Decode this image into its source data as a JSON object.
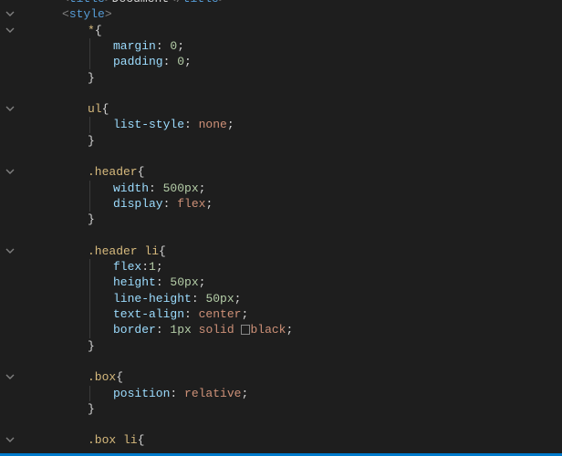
{
  "editor": {
    "file_title": "Document",
    "lines": [
      {
        "indent": 1,
        "tokens": [
          {
            "t": "tag",
            "v": "<"
          },
          {
            "t": "tagname",
            "v": "title"
          },
          {
            "t": "tag",
            "v": ">"
          },
          {
            "t": "text",
            "v": "Document"
          },
          {
            "t": "tag",
            "v": "</"
          },
          {
            "t": "tagname",
            "v": "title"
          },
          {
            "t": "tag",
            "v": ">"
          }
        ]
      },
      {
        "indent": 1,
        "fold": true,
        "tokens": [
          {
            "t": "tag",
            "v": "<"
          },
          {
            "t": "tagname",
            "v": "style"
          },
          {
            "t": "tag",
            "v": ">"
          }
        ]
      },
      {
        "indent": 2,
        "fold": true,
        "tokens": [
          {
            "t": "sel",
            "v": "*"
          },
          {
            "t": "brace",
            "v": "{"
          }
        ]
      },
      {
        "indent": 3,
        "guide": true,
        "tokens": [
          {
            "t": "prop",
            "v": "margin"
          },
          {
            "t": "punct",
            "v": ": "
          },
          {
            "t": "num",
            "v": "0"
          },
          {
            "t": "punct",
            "v": ";"
          }
        ]
      },
      {
        "indent": 3,
        "guide": true,
        "tokens": [
          {
            "t": "prop",
            "v": "padding"
          },
          {
            "t": "punct",
            "v": ": "
          },
          {
            "t": "num",
            "v": "0"
          },
          {
            "t": "punct",
            "v": ";"
          }
        ]
      },
      {
        "indent": 2,
        "tokens": [
          {
            "t": "brace",
            "v": "}"
          }
        ]
      },
      {
        "indent": 0,
        "tokens": []
      },
      {
        "indent": 2,
        "fold": true,
        "tokens": [
          {
            "t": "sel",
            "v": "ul"
          },
          {
            "t": "brace",
            "v": "{"
          }
        ]
      },
      {
        "indent": 3,
        "guide": true,
        "tokens": [
          {
            "t": "prop",
            "v": "list-style"
          },
          {
            "t": "punct",
            "v": ": "
          },
          {
            "t": "val",
            "v": "none"
          },
          {
            "t": "punct",
            "v": ";"
          }
        ]
      },
      {
        "indent": 2,
        "tokens": [
          {
            "t": "brace",
            "v": "}"
          }
        ]
      },
      {
        "indent": 0,
        "tokens": []
      },
      {
        "indent": 2,
        "fold": true,
        "tokens": [
          {
            "t": "sel",
            "v": ".header"
          },
          {
            "t": "brace",
            "v": "{"
          }
        ]
      },
      {
        "indent": 3,
        "guide": true,
        "tokens": [
          {
            "t": "prop",
            "v": "width"
          },
          {
            "t": "punct",
            "v": ": "
          },
          {
            "t": "num",
            "v": "500px"
          },
          {
            "t": "punct",
            "v": ";"
          }
        ]
      },
      {
        "indent": 3,
        "guide": true,
        "tokens": [
          {
            "t": "prop",
            "v": "display"
          },
          {
            "t": "punct",
            "v": ": "
          },
          {
            "t": "val",
            "v": "flex"
          },
          {
            "t": "punct",
            "v": ";"
          }
        ]
      },
      {
        "indent": 2,
        "tokens": [
          {
            "t": "brace",
            "v": "}"
          }
        ]
      },
      {
        "indent": 0,
        "tokens": []
      },
      {
        "indent": 2,
        "fold": true,
        "tokens": [
          {
            "t": "sel",
            "v": ".header li"
          },
          {
            "t": "brace",
            "v": "{"
          }
        ]
      },
      {
        "indent": 3,
        "guide": true,
        "tokens": [
          {
            "t": "prop",
            "v": "flex"
          },
          {
            "t": "punct",
            "v": ":"
          },
          {
            "t": "num",
            "v": "1"
          },
          {
            "t": "punct",
            "v": ";"
          }
        ]
      },
      {
        "indent": 3,
        "guide": true,
        "tokens": [
          {
            "t": "prop",
            "v": "height"
          },
          {
            "t": "punct",
            "v": ": "
          },
          {
            "t": "num",
            "v": "50px"
          },
          {
            "t": "punct",
            "v": ";"
          }
        ]
      },
      {
        "indent": 3,
        "guide": true,
        "tokens": [
          {
            "t": "prop",
            "v": "line-height"
          },
          {
            "t": "punct",
            "v": ": "
          },
          {
            "t": "num",
            "v": "50px"
          },
          {
            "t": "punct",
            "v": ";"
          }
        ]
      },
      {
        "indent": 3,
        "guide": true,
        "tokens": [
          {
            "t": "prop",
            "v": "text-align"
          },
          {
            "t": "punct",
            "v": ": "
          },
          {
            "t": "val",
            "v": "center"
          },
          {
            "t": "punct",
            "v": ";"
          }
        ]
      },
      {
        "indent": 3,
        "guide": true,
        "tokens": [
          {
            "t": "prop",
            "v": "border"
          },
          {
            "t": "punct",
            "v": ": "
          },
          {
            "t": "num",
            "v": "1px"
          },
          {
            "t": "punct",
            "v": " "
          },
          {
            "t": "val",
            "v": "solid"
          },
          {
            "t": "punct",
            "v": " "
          },
          {
            "t": "miss",
            "v": ""
          },
          {
            "t": "val",
            "v": "black"
          },
          {
            "t": "punct",
            "v": ";"
          }
        ]
      },
      {
        "indent": 2,
        "tokens": [
          {
            "t": "brace",
            "v": "}"
          }
        ]
      },
      {
        "indent": 0,
        "tokens": []
      },
      {
        "indent": 2,
        "fold": true,
        "tokens": [
          {
            "t": "sel",
            "v": ".box"
          },
          {
            "t": "brace",
            "v": "{"
          }
        ]
      },
      {
        "indent": 3,
        "guide": true,
        "tokens": [
          {
            "t": "prop",
            "v": "position"
          },
          {
            "t": "punct",
            "v": ": "
          },
          {
            "t": "val",
            "v": "relative"
          },
          {
            "t": "punct",
            "v": ";"
          }
        ]
      },
      {
        "indent": 2,
        "tokens": [
          {
            "t": "brace",
            "v": "}"
          }
        ]
      },
      {
        "indent": 0,
        "tokens": []
      },
      {
        "indent": 2,
        "fold": true,
        "tokens": [
          {
            "t": "sel",
            "v": ".box li"
          },
          {
            "t": "brace",
            "v": "{"
          }
        ]
      }
    ]
  }
}
